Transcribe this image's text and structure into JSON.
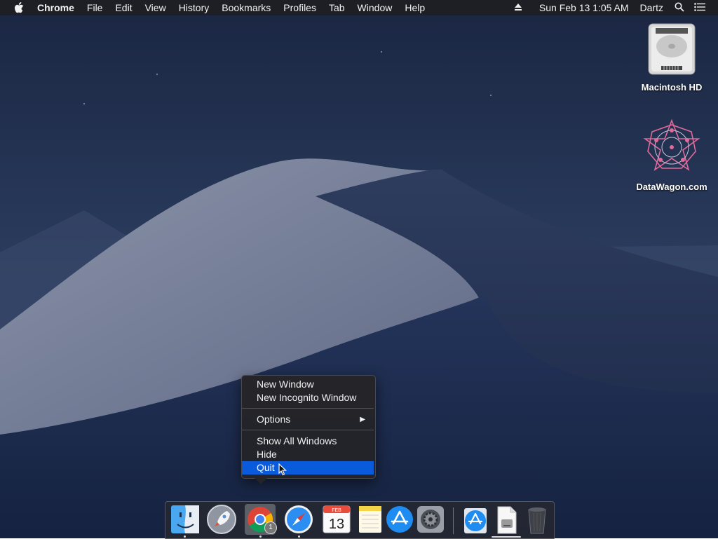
{
  "menubar": {
    "app_name": "Chrome",
    "items": [
      "File",
      "Edit",
      "View",
      "History",
      "Bookmarks",
      "Profiles",
      "Tab",
      "Window",
      "Help"
    ],
    "clock": "Sun Feb 13  1:05 AM",
    "user": "Dartz"
  },
  "desktop_icons": [
    {
      "label": "Macintosh HD",
      "icon": "hard-drive-icon"
    },
    {
      "label": "DataWagon.com",
      "icon": "datawagon-logo-icon"
    }
  ],
  "context_menu": {
    "items": [
      "New Window",
      "New Incognito Window",
      "Options",
      "Show All Windows",
      "Hide",
      "Quit"
    ],
    "highlighted": "Quit",
    "submenu_arrow": "▶"
  },
  "dock": {
    "apps": [
      {
        "name": "Finder",
        "icon": "finder-icon",
        "running": true
      },
      {
        "name": "Launchpad",
        "icon": "launchpad-icon",
        "running": false
      },
      {
        "name": "Google Chrome",
        "icon": "chrome-icon",
        "running": true,
        "badge": "1"
      },
      {
        "name": "Safari",
        "icon": "safari-icon",
        "running": true
      },
      {
        "name": "Calendar",
        "icon": "calendar-icon",
        "running": false,
        "month": "FEB",
        "day": "13"
      },
      {
        "name": "Notes",
        "icon": "notes-icon",
        "running": false
      },
      {
        "name": "App Store",
        "icon": "app-store-icon",
        "running": false
      },
      {
        "name": "System Preferences",
        "icon": "system-preferences-icon",
        "running": false
      },
      {
        "name": "Downloads",
        "icon": "downloads-stack-icon",
        "running": false
      },
      {
        "name": "Document",
        "icon": "document-icon",
        "running": false
      },
      {
        "name": "Trash",
        "icon": "trash-icon",
        "running": false
      }
    ]
  },
  "colors": {
    "menu_highlight": "#0a5bdc",
    "menubar_bg": "#1e1e22",
    "sky": "#1b2a44"
  }
}
